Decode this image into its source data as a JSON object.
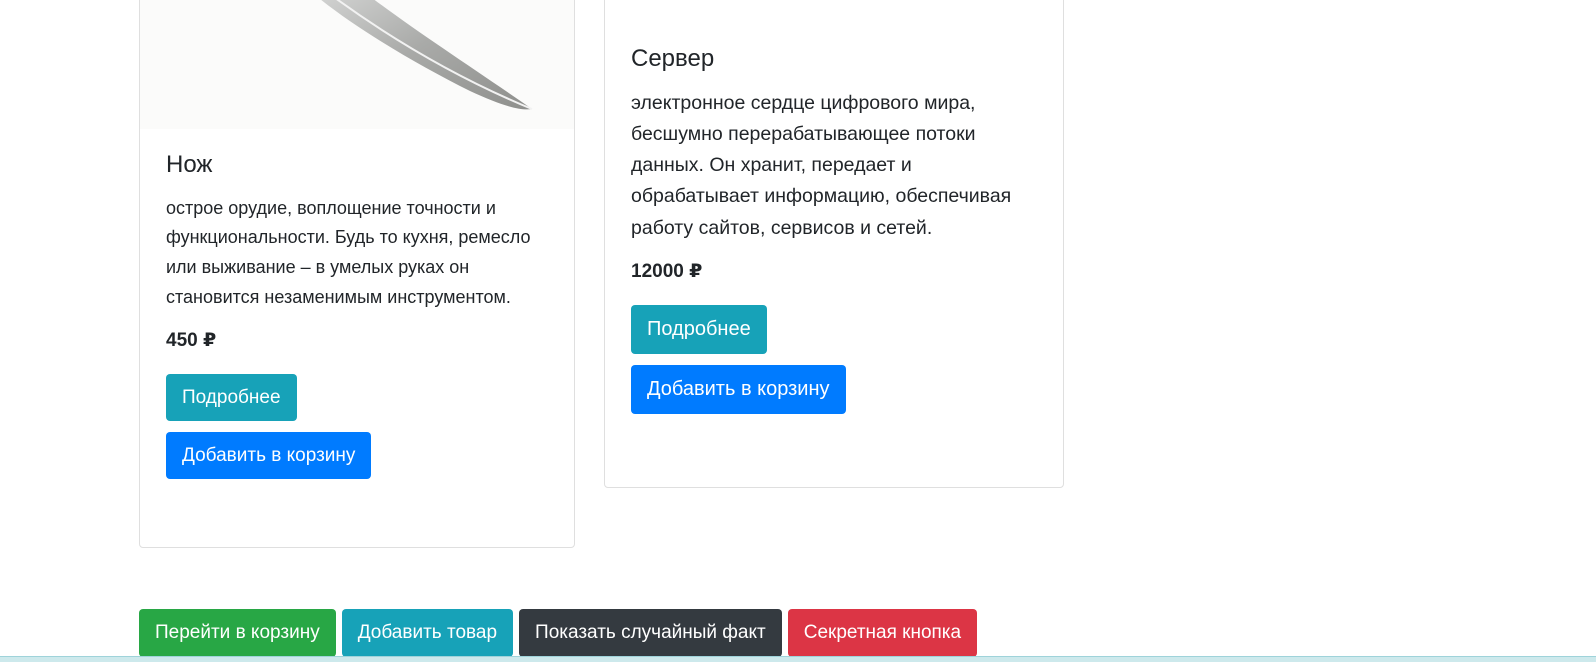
{
  "products": [
    {
      "title": "Нож",
      "description": "острое орудие, воплощение точности и функциональности. Будь то кухня, ремесло или выживание – в умелых руках он становится незаменимым инструментом.",
      "price": "450 ₽",
      "details_label": "Подробнее",
      "add_to_cart_label": "Добавить в корзину"
    },
    {
      "title": "Сервер",
      "description": "электронное сердце цифрового мира, бесшумно перерабатывающее потоки данных. Он хранит, передает и обрабатывает информацию, обеспечивая работу сайтов, сервисов и сетей.",
      "price": "12000 ₽",
      "details_label": "Подробнее",
      "add_to_cart_label": "Добавить в корзину"
    }
  ],
  "actions": {
    "go_to_cart": "Перейти в корзину",
    "add_product": "Добавить товар",
    "random_fact": "Показать случайный факт",
    "secret": "Секретная кнопка"
  },
  "colors": {
    "info": "#17a2b8",
    "primary": "#007bff",
    "success": "#28a745",
    "dark": "#343a40",
    "danger": "#dc3545"
  }
}
